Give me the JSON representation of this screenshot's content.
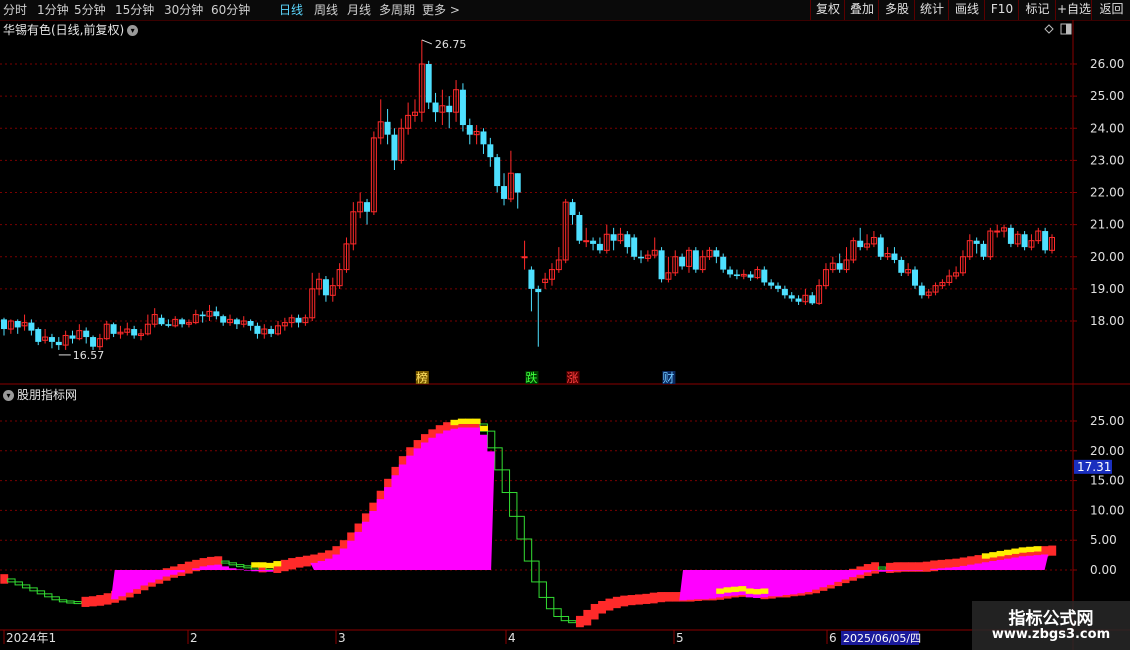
{
  "toolbar": {
    "periods": [
      "分时",
      "1分钟",
      "5分钟",
      "15分钟",
      "30分钟",
      "60分钟",
      "日线",
      "周线",
      "月线",
      "多周期",
      "更多 >"
    ],
    "active_period": "日线",
    "actions": [
      "复权",
      "叠加",
      "多股",
      "统计",
      "画线",
      "F10",
      "标记",
      "+自选",
      "返回"
    ]
  },
  "main_chart": {
    "title": "华锡有色(日线,前复权)",
    "y_ticks": [
      "26.00",
      "25.00",
      "24.00",
      "23.00",
      "22.00",
      "21.00",
      "20.00",
      "19.00",
      "18.00"
    ],
    "high_label": "26.75",
    "low_label": "16.57",
    "event_markers": [
      "榜",
      "跌",
      "涨",
      "财"
    ]
  },
  "indicator": {
    "title": "股朋指标网",
    "y_ticks": [
      "25.00",
      "20.00",
      "15.00",
      "10.00",
      "5.00",
      "0.00"
    ],
    "current_value": "17.31"
  },
  "x_axis": {
    "labels": [
      "2024年1",
      "2",
      "3",
      "4",
      "5",
      "6"
    ],
    "cursor_date": "2025/06/05/四"
  },
  "watermark": {
    "line1": "指标公式网",
    "line2": "www.zbgs3.com"
  },
  "colors": {
    "up": "#ff2a2a",
    "down": "#4ee0ff",
    "grid": "#7a0000",
    "magenta": "#ff00ff",
    "yellow": "#ffee00",
    "green_box": "#33dd33",
    "axis_text": "#e0e0e0"
  },
  "chart_data": {
    "type": "candlestick",
    "candles": [
      {
        "o": 18.05,
        "c": 17.75,
        "h": 18.1,
        "l": 17.55
      },
      {
        "o": 17.75,
        "c": 18.0,
        "h": 18.05,
        "l": 17.6
      },
      {
        "o": 18.0,
        "c": 17.8,
        "h": 18.05,
        "l": 17.6
      },
      {
        "o": 17.85,
        "c": 17.95,
        "h": 18.2,
        "l": 17.7
      },
      {
        "o": 17.95,
        "c": 17.7,
        "h": 18.05,
        "l": 17.55
      },
      {
        "o": 17.75,
        "c": 17.35,
        "h": 17.8,
        "l": 17.25
      },
      {
        "o": 17.4,
        "c": 17.5,
        "h": 17.75,
        "l": 17.3
      },
      {
        "o": 17.5,
        "c": 17.35,
        "h": 17.6,
        "l": 17.15
      },
      {
        "o": 17.35,
        "c": 17.25,
        "h": 17.5,
        "l": 17.1
      },
      {
        "o": 17.25,
        "c": 17.55,
        "h": 17.7,
        "l": 17.1
      },
      {
        "o": 17.55,
        "c": 17.45,
        "h": 17.7,
        "l": 17.3
      },
      {
        "o": 17.45,
        "c": 17.7,
        "h": 17.9,
        "l": 17.4
      },
      {
        "o": 17.7,
        "c": 17.5,
        "h": 17.8,
        "l": 17.3
      },
      {
        "o": 17.5,
        "c": 17.2,
        "h": 17.55,
        "l": 17.1
      },
      {
        "o": 17.2,
        "c": 17.45,
        "h": 17.6,
        "l": 17.1
      },
      {
        "o": 17.45,
        "c": 17.9,
        "h": 18.0,
        "l": 17.4
      },
      {
        "o": 17.9,
        "c": 17.6,
        "h": 17.95,
        "l": 17.5
      },
      {
        "o": 17.6,
        "c": 17.65,
        "h": 17.85,
        "l": 17.45
      },
      {
        "o": 17.65,
        "c": 17.75,
        "h": 17.95,
        "l": 17.55
      },
      {
        "o": 17.75,
        "c": 17.55,
        "h": 17.85,
        "l": 17.45
      },
      {
        "o": 17.55,
        "c": 17.6,
        "h": 17.75,
        "l": 17.4
      },
      {
        "o": 17.6,
        "c": 17.9,
        "h": 18.2,
        "l": 17.55
      },
      {
        "o": 17.9,
        "c": 18.2,
        "h": 18.4,
        "l": 17.8
      },
      {
        "o": 18.1,
        "c": 17.9,
        "h": 18.2,
        "l": 17.85
      },
      {
        "o": 17.9,
        "c": 17.85,
        "h": 18.05,
        "l": 17.8
      },
      {
        "o": 17.85,
        "c": 18.05,
        "h": 18.15,
        "l": 17.8
      },
      {
        "o": 18.05,
        "c": 17.9,
        "h": 18.1,
        "l": 17.8
      },
      {
        "o": 17.9,
        "c": 17.95,
        "h": 18.05,
        "l": 17.8
      },
      {
        "o": 17.95,
        "c": 18.2,
        "h": 18.35,
        "l": 17.9
      },
      {
        "o": 18.2,
        "c": 18.15,
        "h": 18.3,
        "l": 17.95
      },
      {
        "o": 18.15,
        "c": 18.3,
        "h": 18.5,
        "l": 18.0
      },
      {
        "o": 18.3,
        "c": 18.15,
        "h": 18.45,
        "l": 18.05
      },
      {
        "o": 18.15,
        "c": 17.95,
        "h": 18.2,
        "l": 17.85
      },
      {
        "o": 17.95,
        "c": 18.05,
        "h": 18.2,
        "l": 17.85
      },
      {
        "o": 18.05,
        "c": 17.9,
        "h": 18.1,
        "l": 17.75
      },
      {
        "o": 17.9,
        "c": 18.0,
        "h": 18.15,
        "l": 17.8
      },
      {
        "o": 18.0,
        "c": 17.85,
        "h": 18.05,
        "l": 17.7
      },
      {
        "o": 17.85,
        "c": 17.6,
        "h": 17.95,
        "l": 17.45
      },
      {
        "o": 17.6,
        "c": 17.75,
        "h": 17.9,
        "l": 17.45
      },
      {
        "o": 17.75,
        "c": 17.6,
        "h": 17.85,
        "l": 17.5
      },
      {
        "o": 17.6,
        "c": 17.85,
        "h": 18.0,
        "l": 17.55
      },
      {
        "o": 17.85,
        "c": 17.95,
        "h": 18.1,
        "l": 17.7
      },
      {
        "o": 17.95,
        "c": 18.1,
        "h": 18.2,
        "l": 17.8
      },
      {
        "o": 18.1,
        "c": 17.95,
        "h": 18.2,
        "l": 17.8
      },
      {
        "o": 17.95,
        "c": 18.1,
        "h": 18.2,
        "l": 17.85
      },
      {
        "o": 18.1,
        "c": 19.0,
        "h": 19.5,
        "l": 18.0
      },
      {
        "o": 19.0,
        "c": 19.3,
        "h": 19.5,
        "l": 18.8
      },
      {
        "o": 19.3,
        "c": 18.8,
        "h": 19.4,
        "l": 18.6
      },
      {
        "o": 18.8,
        "c": 19.1,
        "h": 19.35,
        "l": 18.6
      },
      {
        "o": 19.1,
        "c": 19.6,
        "h": 19.8,
        "l": 19.0
      },
      {
        "o": 19.6,
        "c": 20.4,
        "h": 20.6,
        "l": 19.5
      },
      {
        "o": 20.4,
        "c": 21.4,
        "h": 21.7,
        "l": 20.2
      },
      {
        "o": 21.4,
        "c": 21.7,
        "h": 22.0,
        "l": 21.2
      },
      {
        "o": 21.7,
        "c": 21.4,
        "h": 21.8,
        "l": 21.0
      },
      {
        "o": 21.4,
        "c": 23.7,
        "h": 23.9,
        "l": 21.3
      },
      {
        "o": 23.7,
        "c": 24.2,
        "h": 24.9,
        "l": 23.5
      },
      {
        "o": 24.2,
        "c": 23.8,
        "h": 24.6,
        "l": 23.5
      },
      {
        "o": 23.8,
        "c": 23.0,
        "h": 24.0,
        "l": 22.7
      },
      {
        "o": 23.0,
        "c": 24.0,
        "h": 24.3,
        "l": 22.9
      },
      {
        "o": 24.0,
        "c": 24.4,
        "h": 24.8,
        "l": 23.8
      },
      {
        "o": 24.4,
        "c": 24.5,
        "h": 24.9,
        "l": 24.2
      },
      {
        "o": 24.5,
        "c": 26.0,
        "h": 26.75,
        "l": 24.2
      },
      {
        "o": 26.0,
        "c": 24.8,
        "h": 26.1,
        "l": 24.6
      },
      {
        "o": 24.8,
        "c": 24.5,
        "h": 25.1,
        "l": 24.2
      },
      {
        "o": 24.5,
        "c": 24.7,
        "h": 25.2,
        "l": 24.1
      },
      {
        "o": 24.7,
        "c": 24.5,
        "h": 25.0,
        "l": 24.0
      },
      {
        "o": 24.5,
        "c": 25.2,
        "h": 25.5,
        "l": 24.2
      },
      {
        "o": 25.2,
        "c": 24.1,
        "h": 25.4,
        "l": 23.9
      },
      {
        "o": 24.1,
        "c": 23.8,
        "h": 24.3,
        "l": 23.5
      },
      {
        "o": 23.8,
        "c": 23.9,
        "h": 24.1,
        "l": 23.5
      },
      {
        "o": 23.9,
        "c": 23.5,
        "h": 24.0,
        "l": 23.2
      },
      {
        "o": 23.5,
        "c": 23.1,
        "h": 23.7,
        "l": 22.8
      },
      {
        "o": 23.1,
        "c": 22.2,
        "h": 23.2,
        "l": 22.0
      },
      {
        "o": 22.2,
        "c": 21.8,
        "h": 22.6,
        "l": 21.6
      },
      {
        "o": 21.8,
        "c": 22.6,
        "h": 23.3,
        "l": 21.7
      },
      {
        "o": 22.6,
        "c": 22.0,
        "h": 22.6,
        "l": 21.5
      },
      {
        "o": 20.0,
        "c": 20.0,
        "h": 20.5,
        "l": 19.6
      },
      {
        "o": 19.6,
        "c": 19.0,
        "h": 19.7,
        "l": 18.3
      },
      {
        "o": 19.0,
        "c": 18.9,
        "h": 19.1,
        "l": 17.2
      },
      {
        "o": 19.2,
        "c": 19.3,
        "h": 19.5,
        "l": 19.0
      },
      {
        "o": 19.3,
        "c": 19.6,
        "h": 19.8,
        "l": 19.1
      },
      {
        "o": 19.6,
        "c": 19.9,
        "h": 20.3,
        "l": 19.5
      },
      {
        "o": 19.9,
        "c": 21.7,
        "h": 21.8,
        "l": 19.8
      },
      {
        "o": 21.7,
        "c": 21.3,
        "h": 21.8,
        "l": 21.0
      },
      {
        "o": 21.3,
        "c": 20.5,
        "h": 21.4,
        "l": 20.4
      },
      {
        "o": 20.5,
        "c": 20.5,
        "h": 20.9,
        "l": 20.3
      },
      {
        "o": 20.5,
        "c": 20.4,
        "h": 20.6,
        "l": 20.2
      },
      {
        "o": 20.4,
        "c": 20.2,
        "h": 20.6,
        "l": 20.1
      },
      {
        "o": 20.2,
        "c": 20.7,
        "h": 21.0,
        "l": 20.1
      },
      {
        "o": 20.7,
        "c": 20.5,
        "h": 20.9,
        "l": 20.2
      },
      {
        "o": 20.5,
        "c": 20.7,
        "h": 20.9,
        "l": 20.4
      },
      {
        "o": 20.7,
        "c": 20.3,
        "h": 20.8,
        "l": 20.1
      },
      {
        "o": 20.6,
        "c": 20.0,
        "h": 20.7,
        "l": 19.9
      },
      {
        "o": 20.0,
        "c": 19.95,
        "h": 20.2,
        "l": 19.8
      },
      {
        "o": 19.95,
        "c": 20.05,
        "h": 20.2,
        "l": 19.85
      },
      {
        "o": 20.05,
        "c": 20.2,
        "h": 20.6,
        "l": 19.95
      },
      {
        "o": 20.2,
        "c": 19.3,
        "h": 20.3,
        "l": 19.2
      },
      {
        "o": 19.3,
        "c": 19.5,
        "h": 20.0,
        "l": 19.2
      },
      {
        "o": 19.5,
        "c": 20.0,
        "h": 20.2,
        "l": 19.4
      },
      {
        "o": 20.0,
        "c": 19.7,
        "h": 20.1,
        "l": 19.6
      },
      {
        "o": 19.7,
        "c": 20.2,
        "h": 20.3,
        "l": 19.5
      },
      {
        "o": 20.2,
        "c": 19.6,
        "h": 20.3,
        "l": 19.5
      },
      {
        "o": 19.6,
        "c": 20.0,
        "h": 20.2,
        "l": 19.5
      },
      {
        "o": 20.0,
        "c": 20.2,
        "h": 20.3,
        "l": 19.9
      },
      {
        "o": 20.2,
        "c": 20.0,
        "h": 20.3,
        "l": 19.8
      },
      {
        "o": 20.0,
        "c": 19.6,
        "h": 20.1,
        "l": 19.5
      },
      {
        "o": 19.6,
        "c": 19.45,
        "h": 19.7,
        "l": 19.35
      },
      {
        "o": 19.45,
        "c": 19.4,
        "h": 19.6,
        "l": 19.3
      },
      {
        "o": 19.4,
        "c": 19.45,
        "h": 19.6,
        "l": 19.3
      },
      {
        "o": 19.45,
        "c": 19.35,
        "h": 19.55,
        "l": 19.25
      },
      {
        "o": 19.35,
        "c": 19.6,
        "h": 19.7,
        "l": 19.3
      },
      {
        "o": 19.6,
        "c": 19.2,
        "h": 19.7,
        "l": 19.1
      },
      {
        "o": 19.2,
        "c": 19.1,
        "h": 19.3,
        "l": 19.0
      },
      {
        "o": 19.1,
        "c": 19.0,
        "h": 19.2,
        "l": 18.9
      },
      {
        "o": 19.0,
        "c": 18.8,
        "h": 19.1,
        "l": 18.7
      },
      {
        "o": 18.8,
        "c": 18.7,
        "h": 18.9,
        "l": 18.6
      },
      {
        "o": 18.7,
        "c": 18.6,
        "h": 18.8,
        "l": 18.5
      },
      {
        "o": 18.6,
        "c": 18.8,
        "h": 19.0,
        "l": 18.5
      },
      {
        "o": 18.8,
        "c": 18.55,
        "h": 18.9,
        "l": 18.5
      },
      {
        "o": 18.55,
        "c": 19.1,
        "h": 19.3,
        "l": 18.5
      },
      {
        "o": 19.1,
        "c": 19.6,
        "h": 19.8,
        "l": 19.0
      },
      {
        "o": 19.6,
        "c": 19.8,
        "h": 20.0,
        "l": 19.5
      },
      {
        "o": 19.8,
        "c": 19.6,
        "h": 20.1,
        "l": 19.5
      },
      {
        "o": 19.6,
        "c": 19.9,
        "h": 20.3,
        "l": 19.5
      },
      {
        "o": 19.9,
        "c": 20.5,
        "h": 20.6,
        "l": 19.8
      },
      {
        "o": 20.5,
        "c": 20.3,
        "h": 20.9,
        "l": 20.2
      },
      {
        "o": 20.3,
        "c": 20.4,
        "h": 20.7,
        "l": 20.2
      },
      {
        "o": 20.4,
        "c": 20.6,
        "h": 20.8,
        "l": 20.3
      },
      {
        "o": 20.6,
        "c": 20.0,
        "h": 20.7,
        "l": 19.9
      },
      {
        "o": 20.0,
        "c": 20.1,
        "h": 20.3,
        "l": 19.9
      },
      {
        "o": 20.1,
        "c": 19.9,
        "h": 20.3,
        "l": 19.8
      },
      {
        "o": 19.9,
        "c": 19.5,
        "h": 20.0,
        "l": 19.4
      },
      {
        "o": 19.5,
        "c": 19.6,
        "h": 19.8,
        "l": 19.4
      },
      {
        "o": 19.6,
        "c": 19.1,
        "h": 19.7,
        "l": 19.0
      },
      {
        "o": 19.1,
        "c": 18.8,
        "h": 19.2,
        "l": 18.7
      },
      {
        "o": 18.8,
        "c": 18.9,
        "h": 19.0,
        "l": 18.7
      },
      {
        "o": 18.9,
        "c": 19.1,
        "h": 19.2,
        "l": 18.8
      },
      {
        "o": 19.1,
        "c": 19.2,
        "h": 19.3,
        "l": 19.0
      },
      {
        "o": 19.2,
        "c": 19.4,
        "h": 19.6,
        "l": 19.1
      },
      {
        "o": 19.4,
        "c": 19.5,
        "h": 19.7,
        "l": 19.3
      },
      {
        "o": 19.5,
        "c": 20.0,
        "h": 20.2,
        "l": 19.4
      },
      {
        "o": 20.0,
        "c": 20.5,
        "h": 20.7,
        "l": 19.9
      },
      {
        "o": 20.5,
        "c": 20.4,
        "h": 20.6,
        "l": 20.1
      },
      {
        "o": 20.4,
        "c": 20.0,
        "h": 20.5,
        "l": 19.9
      },
      {
        "o": 20.0,
        "c": 20.8,
        "h": 20.9,
        "l": 19.9
      },
      {
        "o": 20.8,
        "c": 20.8,
        "h": 21.0,
        "l": 20.6
      },
      {
        "o": 20.8,
        "c": 20.9,
        "h": 21.0,
        "l": 20.6
      },
      {
        "o": 20.9,
        "c": 20.4,
        "h": 21.0,
        "l": 20.3
      },
      {
        "o": 20.4,
        "c": 20.7,
        "h": 20.8,
        "l": 20.3
      },
      {
        "o": 20.7,
        "c": 20.3,
        "h": 20.8,
        "l": 20.2
      },
      {
        "o": 20.3,
        "c": 20.5,
        "h": 20.7,
        "l": 20.2
      },
      {
        "o": 20.5,
        "c": 20.8,
        "h": 20.9,
        "l": 20.4
      },
      {
        "o": 20.8,
        "c": 20.2,
        "h": 20.9,
        "l": 20.1
      },
      {
        "o": 20.2,
        "c": 20.6,
        "h": 20.7,
        "l": 20.1
      }
    ],
    "indicator": {
      "lower": [
        -1.5,
        -2.0,
        -2.5,
        -3.0,
        -3.5,
        -4.0,
        -4.5,
        -5.0,
        -5.2,
        -5.3,
        -5.4,
        -5.3,
        -5.2,
        -5.0,
        -4.7,
        -4.3,
        -3.8,
        -3.2,
        -2.6,
        -2.0,
        -1.5,
        -1.0,
        -0.5,
        -0.2,
        0.2,
        0.6,
        0.9,
        1.2,
        1.4,
        1.5,
        1.2,
        0.9,
        0.7,
        0.5,
        0.4,
        0.4,
        0.3,
        0.6,
        0.9,
        1.2,
        1.4,
        1.6,
        1.8,
        2.1,
        2.5,
        3.2,
        4.2,
        5.5,
        7.0,
        8.7,
        10.5,
        12.5,
        14.5,
        16.5,
        18.3,
        19.8,
        21.0,
        22.0,
        22.8,
        23.5,
        24.0,
        24.3,
        24.5,
        24.5,
        24.5,
        23.3,
        20.5,
        16.8,
        13.0,
        9.0,
        5.2,
        1.5,
        -2.0,
        -4.6,
        -6.5,
        -7.8,
        -8.5,
        -8.8,
        -8.5,
        -7.5,
        -6.5,
        -6.0,
        -5.6,
        -5.3,
        -5.1,
        -5.0,
        -4.9,
        -4.8,
        -4.6,
        -4.5,
        -4.5,
        -4.5,
        -4.5,
        -4.4,
        -4.3,
        -4.3,
        -4.2,
        -4.0,
        -3.8,
        -3.7,
        -3.6,
        -4.0,
        -4.1,
        -4.0,
        -3.8,
        -3.8,
        -3.6,
        -3.5,
        -3.3,
        -3.1,
        -2.7,
        -2.3,
        -1.9,
        -1.4,
        -1.0,
        -0.6,
        -0.2,
        0.2,
        0.5,
        0.3,
        0.4,
        0.5,
        0.5,
        0.5,
        0.5,
        0.6,
        0.8,
        0.9,
        1.0,
        1.1,
        1.3,
        1.5,
        1.7,
        1.9,
        2.1,
        2.3,
        2.5,
        2.7,
        2.9,
        3.0,
        3.1,
        3.2,
        3.3
      ],
      "upper": [
        -1.5,
        -2.0,
        -2.5,
        -3.0,
        -3.5,
        -4.0,
        -4.5,
        -5.0,
        -5.2,
        -5.3,
        -5.4,
        -5.3,
        -5.2,
        -5.0,
        -4.7,
        -4.3,
        -3.8,
        -3.2,
        -2.6,
        -2.0,
        -1.5,
        -1.0,
        -0.5,
        -0.2,
        0.2,
        0.6,
        0.9,
        1.2,
        1.4,
        1.5,
        1.2,
        0.9,
        0.7,
        0.5,
        0.4,
        0.4,
        0.3,
        0.6,
        0.9,
        1.2,
        1.4,
        1.6,
        1.8,
        2.1,
        2.5,
        3.2,
        4.2,
        5.5,
        7.0,
        8.7,
        10.5,
        12.5,
        14.5,
        16.5,
        18.3,
        19.8,
        21.0,
        22.0,
        22.8,
        23.5,
        24.0,
        24.3,
        24.5,
        24.5,
        24.5,
        23.3,
        20.5,
        16.8,
        13.0,
        9.0,
        5.2,
        1.5,
        -2.0,
        -4.6,
        -6.5,
        -7.8,
        -8.5,
        -8.8,
        -8.5,
        -7.5,
        -6.5,
        -6.0,
        -5.6,
        -5.3,
        -5.1,
        -5.0,
        -4.9,
        -4.8,
        -4.6,
        -4.5,
        -4.5,
        -4.5,
        -4.5,
        -4.4,
        -4.3,
        -4.3,
        -4.2,
        -4.0,
        -3.8,
        -3.7,
        -3.6,
        -4.0,
        -4.1,
        -4.0,
        -3.8,
        -3.8,
        -3.6,
        -3.5,
        -3.3,
        -3.1,
        -2.7,
        -2.3,
        -1.9,
        -1.4,
        -1.0,
        -0.6,
        -0.2,
        0.2,
        0.5,
        0.3,
        0.4,
        0.5,
        0.5,
        0.5,
        0.5,
        0.6,
        0.8,
        0.9,
        1.0,
        1.1,
        1.3,
        1.5,
        1.7,
        1.9,
        2.1,
        2.3,
        2.5,
        2.7,
        2.9,
        3.0,
        3.1,
        3.2,
        3.3
      ]
    },
    "main_ylim": [
      16.5,
      27.0
    ],
    "indicator_ylim": [
      -9.5,
      28.0
    ]
  }
}
